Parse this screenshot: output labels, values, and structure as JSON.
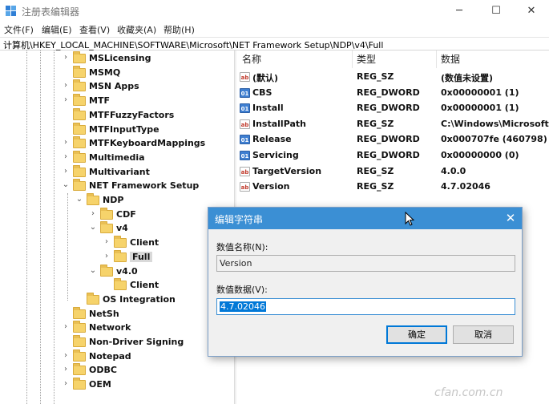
{
  "window": {
    "title": "注册表编辑器",
    "min_label": "─",
    "max_label": "☐",
    "close_label": "✕"
  },
  "menu": [
    "文件(F)",
    "编辑(E)",
    "查看(V)",
    "收藏夹(A)",
    "帮助(H)"
  ],
  "address": "计算机\\HKEY_LOCAL_MACHINE\\SOFTWARE\\Microsoft\\NET Framework Setup\\NDP\\v4\\Full",
  "tree": [
    {
      "label": "MSLicensing",
      "arrow": "›"
    },
    {
      "label": "MSMQ",
      "arrow": ""
    },
    {
      "label": "MSN Apps",
      "arrow": "›"
    },
    {
      "label": "MTF",
      "arrow": "›"
    },
    {
      "label": "MTFFuzzyFactors",
      "arrow": ""
    },
    {
      "label": "MTFInputType",
      "arrow": ""
    },
    {
      "label": "MTFKeyboardMappings",
      "arrow": "›"
    },
    {
      "label": "Multimedia",
      "arrow": "›"
    },
    {
      "label": "Multivariant",
      "arrow": "›"
    },
    {
      "label": "NET Framework Setup",
      "arrow": "⌄"
    },
    {
      "label": "NDP",
      "arrow": "⌄"
    },
    {
      "label": "CDF",
      "arrow": "›"
    },
    {
      "label": "v4",
      "arrow": "⌄"
    },
    {
      "label": "Client",
      "arrow": "›"
    },
    {
      "label": "Full",
      "arrow": "›",
      "selected": true
    },
    {
      "label": "v4.0",
      "arrow": "⌄"
    },
    {
      "label": "Client",
      "arrow": ""
    },
    {
      "label": "OS Integration",
      "arrow": ""
    },
    {
      "label": "NetSh",
      "arrow": ""
    },
    {
      "label": "Network",
      "arrow": "›"
    },
    {
      "label": "Non-Driver Signing",
      "arrow": ""
    },
    {
      "label": "Notepad",
      "arrow": "›"
    },
    {
      "label": "ODBC",
      "arrow": "›"
    },
    {
      "label": "OEM",
      "arrow": "›"
    }
  ],
  "columns": {
    "name": "名称",
    "type": "类型",
    "data": "数据"
  },
  "values": [
    {
      "name": "(默认)",
      "type": "REG_SZ",
      "data": "(数值未设置)",
      "icon": "sz"
    },
    {
      "name": "CBS",
      "type": "REG_DWORD",
      "data": "0x00000001 (1)",
      "icon": "dw"
    },
    {
      "name": "Install",
      "type": "REG_DWORD",
      "data": "0x00000001 (1)",
      "icon": "dw"
    },
    {
      "name": "InstallPath",
      "type": "REG_SZ",
      "data": "C:\\Windows\\Microsoft.NET\\F",
      "icon": "sz"
    },
    {
      "name": "Release",
      "type": "REG_DWORD",
      "data": "0x000707fe (460798)",
      "icon": "dw"
    },
    {
      "name": "Servicing",
      "type": "REG_DWORD",
      "data": "0x00000000 (0)",
      "icon": "dw"
    },
    {
      "name": "TargetVersion",
      "type": "REG_SZ",
      "data": "4.0.0",
      "icon": "sz"
    },
    {
      "name": "Version",
      "type": "REG_SZ",
      "data": "4.7.02046",
      "icon": "sz"
    }
  ],
  "dialog": {
    "title": "编辑字符串",
    "name_label": "数值名称(N):",
    "name_value": "Version",
    "data_label": "数值数据(V):",
    "data_value": "4.7.02046",
    "ok_label": "确定",
    "cancel_label": "取消",
    "close_label": "✕"
  },
  "watermark": "cfan.com.cn",
  "colors": {
    "dialog_title_bg": "#3b8fd4",
    "selection": "#0078d7",
    "folder": "#f6d36b"
  }
}
